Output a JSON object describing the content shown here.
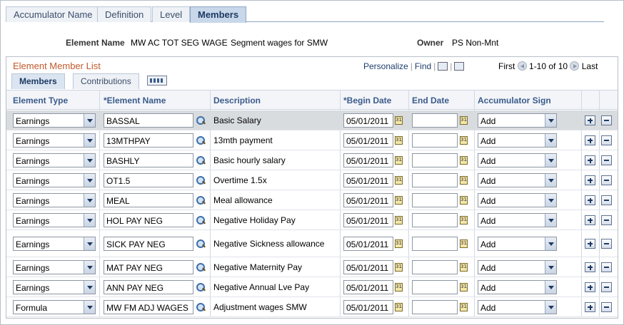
{
  "tabs": [
    {
      "label": "Accumulator Name",
      "active": false
    },
    {
      "label": "Definition",
      "active": false
    },
    {
      "label": "Level",
      "active": false
    },
    {
      "label": "Members",
      "active": true
    }
  ],
  "header": {
    "element_name_label": "Element Name",
    "element_name_code": "MW AC TOT SEG WAGE",
    "element_name_desc": "Segment wages for SMW",
    "owner_label": "Owner",
    "owner_value": "PS Non-Mnt"
  },
  "grid": {
    "title": "Element Member List",
    "personalize": "Personalize",
    "find": "Find",
    "first": "First",
    "range": "1-10 of 10",
    "last": "Last",
    "subtabs": [
      "Members",
      "Contributions"
    ],
    "columns": [
      "Element Type",
      "*Element Name",
      "Description",
      "*Begin Date",
      "End Date",
      "Accumulator Sign"
    ],
    "rows": [
      {
        "type": "Earnings",
        "name": "BASSAL",
        "desc": "Basic Salary",
        "begin": "05/01/2011",
        "end": "",
        "sign": "Add"
      },
      {
        "type": "Earnings",
        "name": "13MTHPAY",
        "desc": "13mth payment",
        "begin": "05/01/2011",
        "end": "",
        "sign": "Add"
      },
      {
        "type": "Earnings",
        "name": "BASHLY",
        "desc": "Basic hourly salary",
        "begin": "05/01/2011",
        "end": "",
        "sign": "Add"
      },
      {
        "type": "Earnings",
        "name": "OT1.5",
        "desc": "Overtime 1.5x",
        "begin": "05/01/2011",
        "end": "",
        "sign": "Add"
      },
      {
        "type": "Earnings",
        "name": "MEAL",
        "desc": "Meal allowance",
        "begin": "05/01/2011",
        "end": "",
        "sign": "Add"
      },
      {
        "type": "Earnings",
        "name": "HOL PAY NEG",
        "desc": "Negative Holiday Pay",
        "begin": "05/01/2011",
        "end": "",
        "sign": "Add"
      },
      {
        "type": "Earnings",
        "name": "SICK PAY NEG",
        "desc": "Negative Sickness allowance",
        "begin": "05/01/2011",
        "end": "",
        "sign": "Add"
      },
      {
        "type": "Earnings",
        "name": "MAT PAY NEG",
        "desc": "Negative Maternity Pay",
        "begin": "05/01/2011",
        "end": "",
        "sign": "Add"
      },
      {
        "type": "Earnings",
        "name": "ANN PAY NEG",
        "desc": "Negative Annual Lve Pay",
        "begin": "05/01/2011",
        "end": "",
        "sign": "Add"
      },
      {
        "type": "Formula",
        "name": "MW FM ADJ WAGES",
        "desc": "Adjustment wages SMW",
        "begin": "05/01/2011",
        "end": "",
        "sign": "Add"
      }
    ]
  }
}
